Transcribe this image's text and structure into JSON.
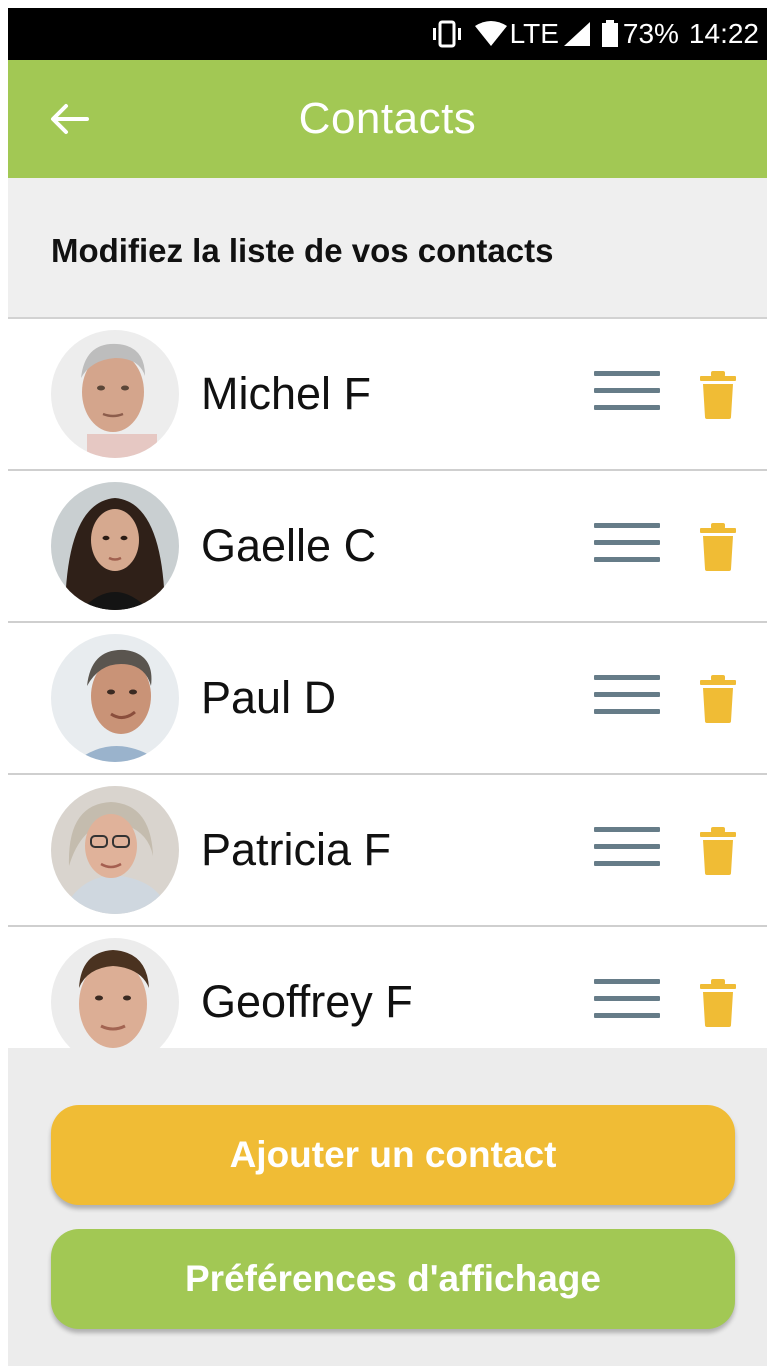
{
  "status_bar": {
    "network": "LTE",
    "battery": "73%",
    "time": "14:22"
  },
  "app_bar": {
    "title": "Contacts",
    "back_icon": "arrow-left-icon"
  },
  "subheader": {
    "text": "Modifiez la liste de vos contacts"
  },
  "contacts": [
    {
      "name": "Michel F"
    },
    {
      "name": "Gaelle C"
    },
    {
      "name": "Paul D"
    },
    {
      "name": "Patricia F"
    },
    {
      "name": "Geoffrey F"
    }
  ],
  "row_icons": {
    "drag": "drag-handle-icon",
    "delete": "trash-icon"
  },
  "buttons": {
    "add_contact": "Ajouter un contact",
    "display_preferences": "Préférences d'affichage"
  },
  "colors": {
    "primary_green": "#a2c854",
    "accent_yellow": "#f0bc35",
    "drag_handle": "#667c88",
    "trash": "#f0bc35"
  }
}
